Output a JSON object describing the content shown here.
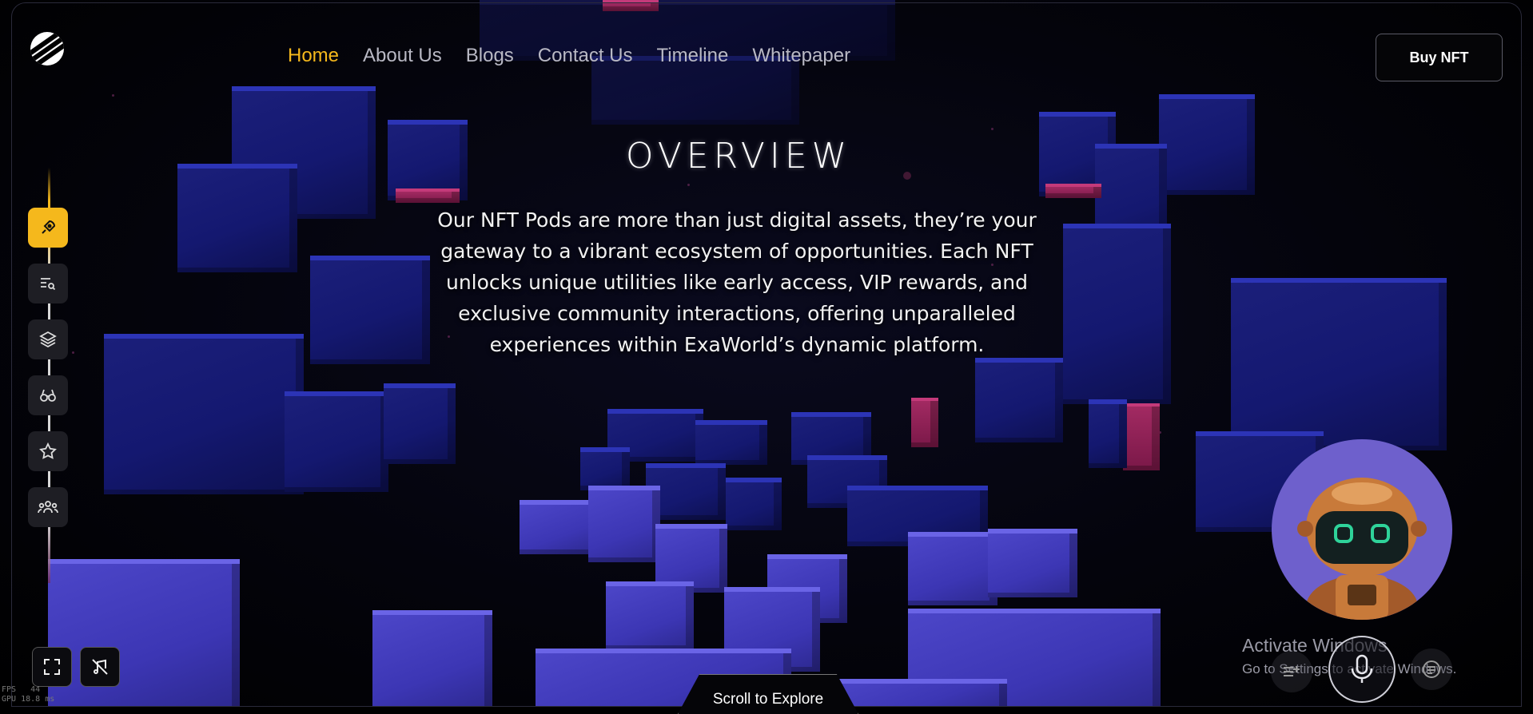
{
  "nav": {
    "items": [
      {
        "label": "Home",
        "active": true
      },
      {
        "label": "About Us",
        "active": false
      },
      {
        "label": "Blogs",
        "active": false
      },
      {
        "label": "Contact Us",
        "active": false
      },
      {
        "label": "Timeline",
        "active": false
      },
      {
        "label": "Whitepaper",
        "active": false
      }
    ],
    "buy_label": "Buy NFT"
  },
  "hero": {
    "title": "OVERVIEW",
    "paragraph": "Our NFT Pods are more than just digital assets, they’re your gateway to a vibrant ecosystem of opportunities. Each NFT unlocks unique utilities like early access, VIP rewards, and exclusive community interactions, offering unparalleled experiences within ExaWorld’s dynamic platform."
  },
  "sidebar": {
    "icons": [
      "rocket-icon",
      "search-list-icon",
      "layers-icon",
      "binoculars-icon",
      "star-icon",
      "community-icon"
    ],
    "active_index": 0
  },
  "bottom": {
    "scroll_label": "Scroll to Explore",
    "fullscreen_icon": "fullscreen-icon",
    "mute_icon": "mute-icon"
  },
  "assistant": {
    "avatar": "robot-icon",
    "mic_icon": "microphone-icon"
  },
  "watermark": {
    "line1": "Activate Windows",
    "line2": "Go to Settings to activate Windows."
  },
  "stats": {
    "fps_label": "FPS",
    "fps_value": "44",
    "gpu_label": "GPU",
    "gpu_value": "18.8 ms"
  },
  "colors": {
    "accent": "#f5b81c",
    "cube": "#1b1f7a",
    "cube_light": "#4c46c8",
    "robot_bg": "#6e60cc"
  }
}
